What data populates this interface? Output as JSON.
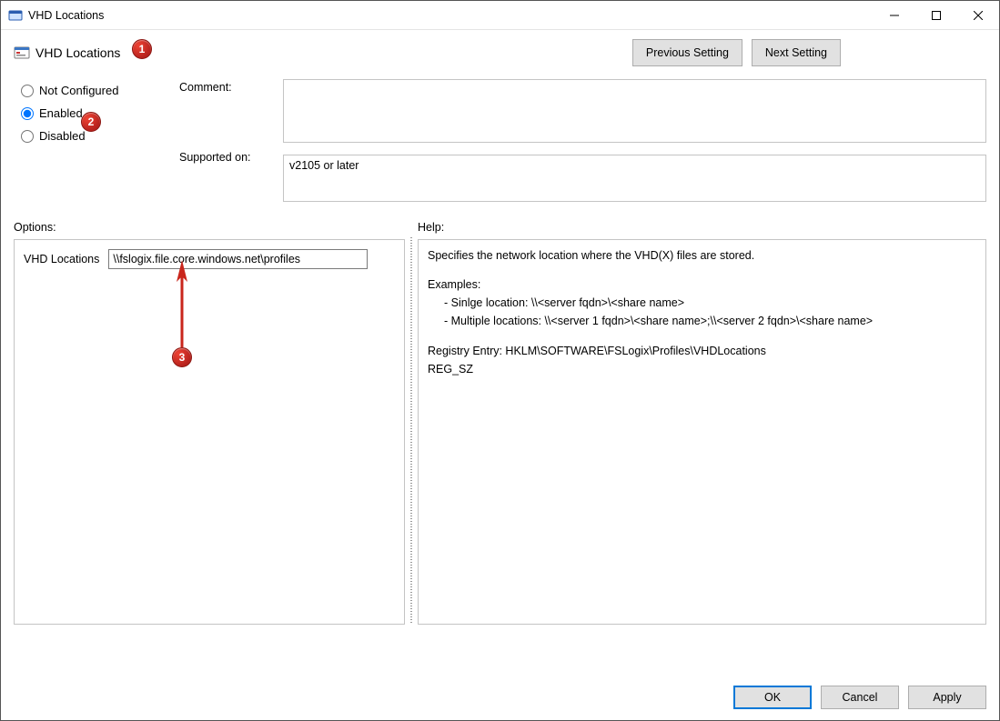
{
  "window": {
    "title": "VHD Locations"
  },
  "heading": "VHD Locations",
  "nav": {
    "prev": "Previous Setting",
    "next": "Next Setting"
  },
  "state": {
    "not_configured": "Not Configured",
    "enabled": "Enabled",
    "disabled": "Disabled",
    "selected": "enabled"
  },
  "labels": {
    "comment": "Comment:",
    "supported_on": "Supported on:",
    "options": "Options:",
    "help": "Help:",
    "vhd_locations": "VHD Locations"
  },
  "values": {
    "comment": "",
    "supported_on": "v2105 or later",
    "vhd_locations": "\\\\fslogix.file.core.windows.net\\profiles"
  },
  "help": {
    "line1": "Specifies the network location where the VHD(X) files are stored.",
    "examples_label": "Examples:",
    "example_single": "- Sinlge location:  \\\\<server fqdn>\\<share name>",
    "example_multi": "- Multiple locations: \\\\<server 1 fqdn>\\<share name>;\\\\<server 2 fqdn>\\<share name>",
    "registry_label": "Registry Entry:  HKLM\\SOFTWARE\\FSLogix\\Profiles\\VHDLocations",
    "reg_type": "REG_SZ"
  },
  "footer": {
    "ok": "OK",
    "cancel": "Cancel",
    "apply": "Apply"
  },
  "callouts": {
    "b1": "1",
    "b2": "2",
    "b3": "3"
  }
}
